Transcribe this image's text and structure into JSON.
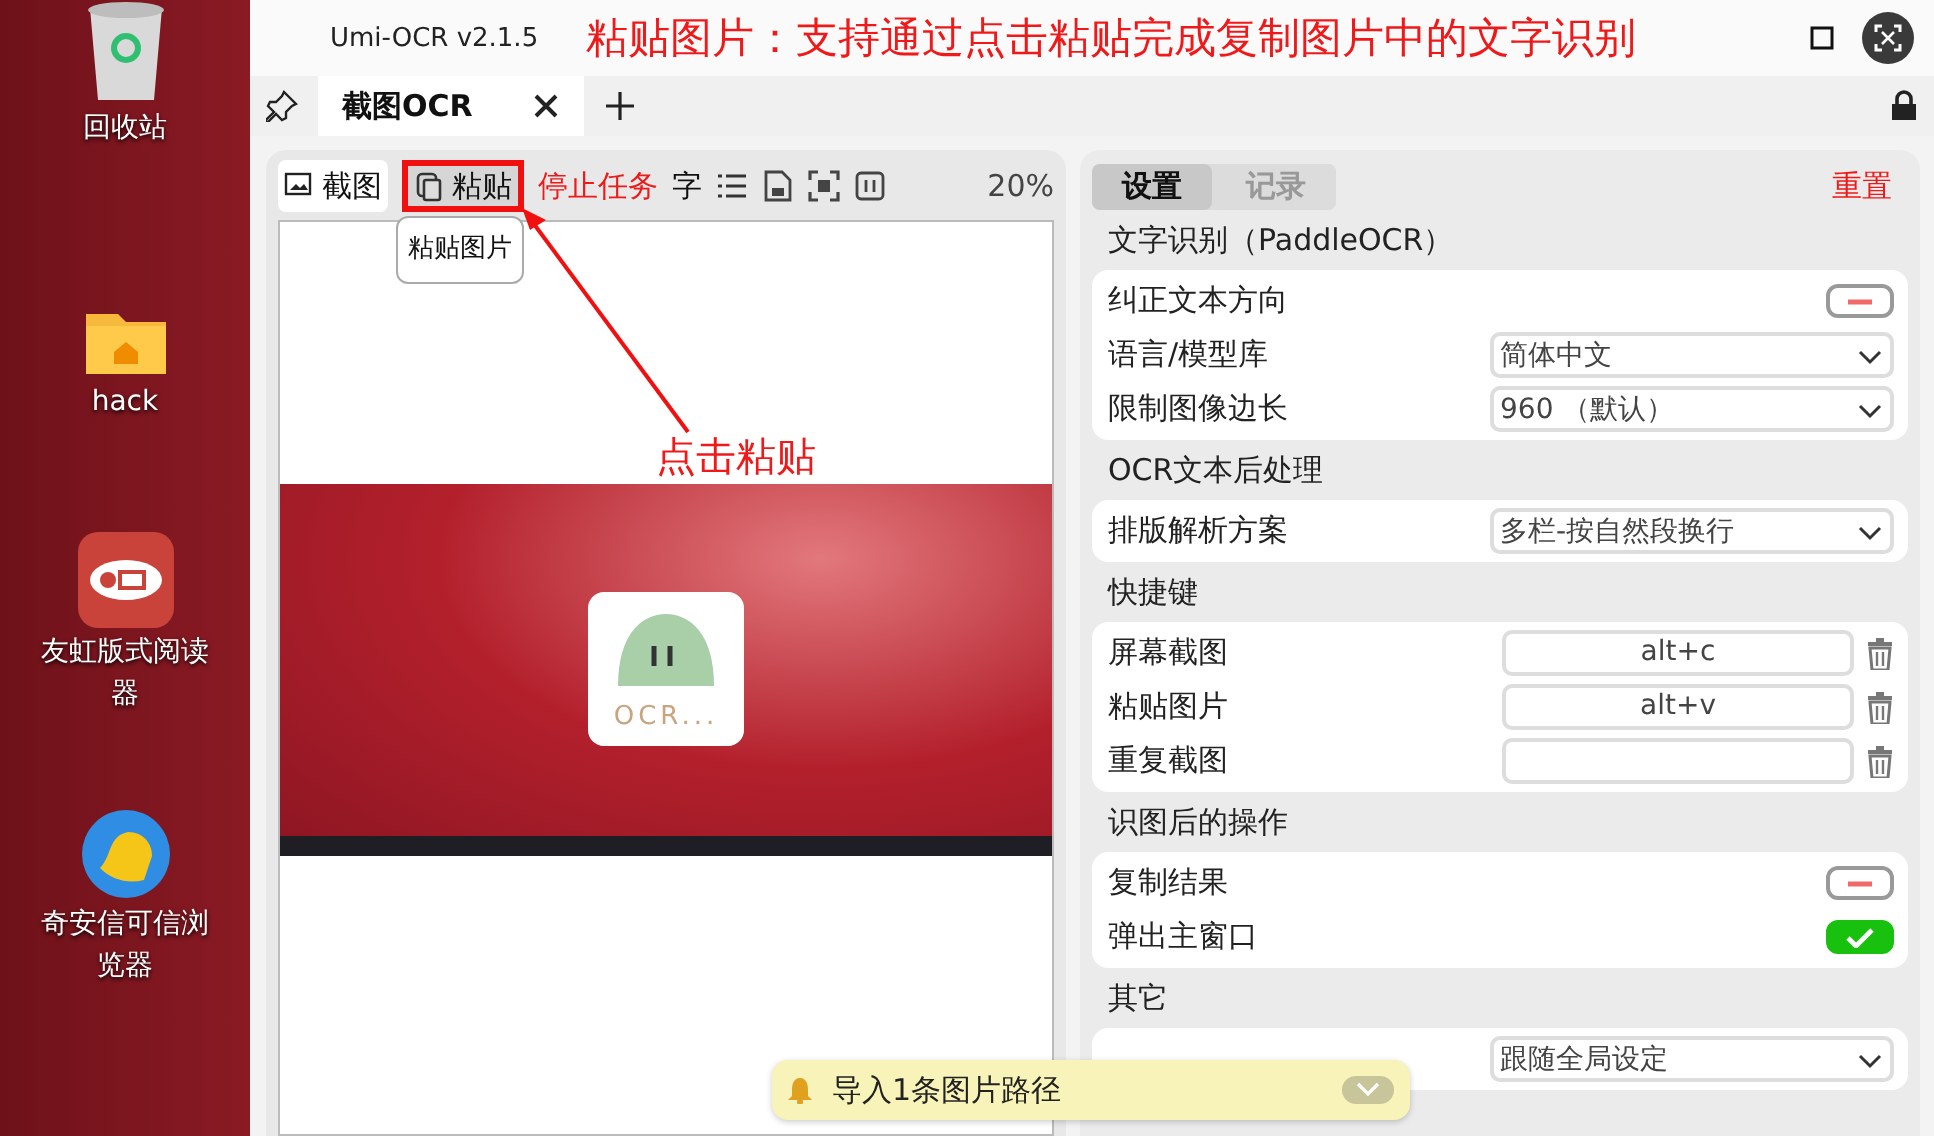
{
  "desktop": {
    "icons": [
      {
        "kind": "trash",
        "label": "回收站"
      },
      {
        "kind": "folder",
        "label": "hack"
      },
      {
        "kind": "reader",
        "label": "友虹版式阅读器"
      },
      {
        "kind": "browser",
        "label": "奇安信可信浏览器"
      }
    ]
  },
  "window": {
    "title": "Umi-OCR v2.1.5"
  },
  "annotations": [
    {
      "kind": "headline",
      "text": "粘贴图片：支持通过点击粘贴完成复制图片中的文字识别"
    },
    {
      "kind": "callout",
      "text": "点击粘贴"
    }
  ],
  "tabs": [
    {
      "label": "截图OCR",
      "selected": true
    }
  ],
  "toolbar": {
    "items": [
      {
        "kind": "screenshot",
        "label": "截图",
        "highlighted": false
      },
      {
        "kind": "paste",
        "label": "粘贴",
        "highlighted": true
      },
      {
        "kind": "stop",
        "label": "停止任务"
      },
      {
        "kind": "text",
        "label": "字"
      },
      {
        "kind": "list"
      },
      {
        "kind": "file"
      },
      {
        "kind": "frame"
      },
      {
        "kind": "panel"
      },
      {
        "kind": "zoom",
        "label": "20%"
      }
    ]
  },
  "tooltip": {
    "text": "粘贴图片"
  },
  "preview": {
    "status": "OCR..."
  },
  "settings": {
    "tabs": [
      {
        "label": "设置",
        "selected": true
      },
      {
        "label": "记录",
        "selected": false
      }
    ],
    "reset": "重置",
    "sections": [
      {
        "title": "文字识别（PaddleOCR）",
        "rows": [
          {
            "kind": "switch",
            "label": "纠正文本方向",
            "on": false
          },
          {
            "kind": "select",
            "label": "语言/模型库",
            "value": "简体中文"
          },
          {
            "kind": "select",
            "label": "限制图像边长",
            "value": "960 （默认）"
          }
        ]
      },
      {
        "title": "OCR文本后处理",
        "rows": [
          {
            "kind": "select",
            "label": "排版解析方案",
            "value": "多栏-按自然段换行"
          }
        ]
      },
      {
        "title": "快捷键",
        "rows": [
          {
            "kind": "hotkey",
            "label": "屏幕截图",
            "value": "alt+c"
          },
          {
            "kind": "hotkey",
            "label": "粘贴图片",
            "value": "alt+v"
          },
          {
            "kind": "hotkey",
            "label": "重复截图"
          }
        ]
      },
      {
        "title": "识图后的操作",
        "rows": [
          {
            "kind": "switch",
            "label": "复制结果",
            "on": false
          },
          {
            "kind": "switch",
            "label": "弹出主窗口",
            "on": true
          }
        ]
      },
      {
        "title": "其它",
        "rows": [
          {
            "kind": "select",
            "value": "跟随全局设定"
          }
        ]
      }
    ]
  },
  "notification": {
    "text": "导入1条图片路径"
  }
}
